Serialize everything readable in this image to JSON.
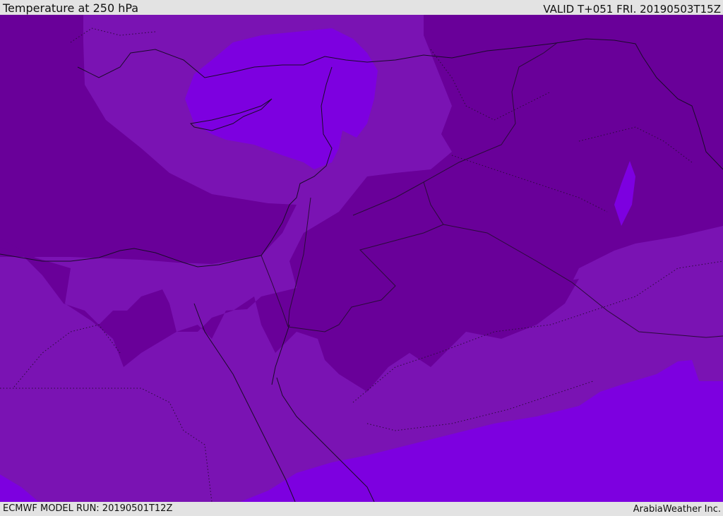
{
  "header": {
    "title": "Temperature at 250 hPa",
    "valid": "VALID T+051 FRI. 20190503T15Z"
  },
  "footer": {
    "model_run": "ECMWF MODEL RUN: 20190501T12Z",
    "credit": "ArabiaWeather Inc."
  },
  "colors": {
    "base_field": "#7a13b3",
    "cold_field": "#690099",
    "warm_field": "#7d00e0",
    "coastline": "#1a0a2a",
    "border_line": "#2a0a3a",
    "bar_background": "#e3e3e3"
  }
}
